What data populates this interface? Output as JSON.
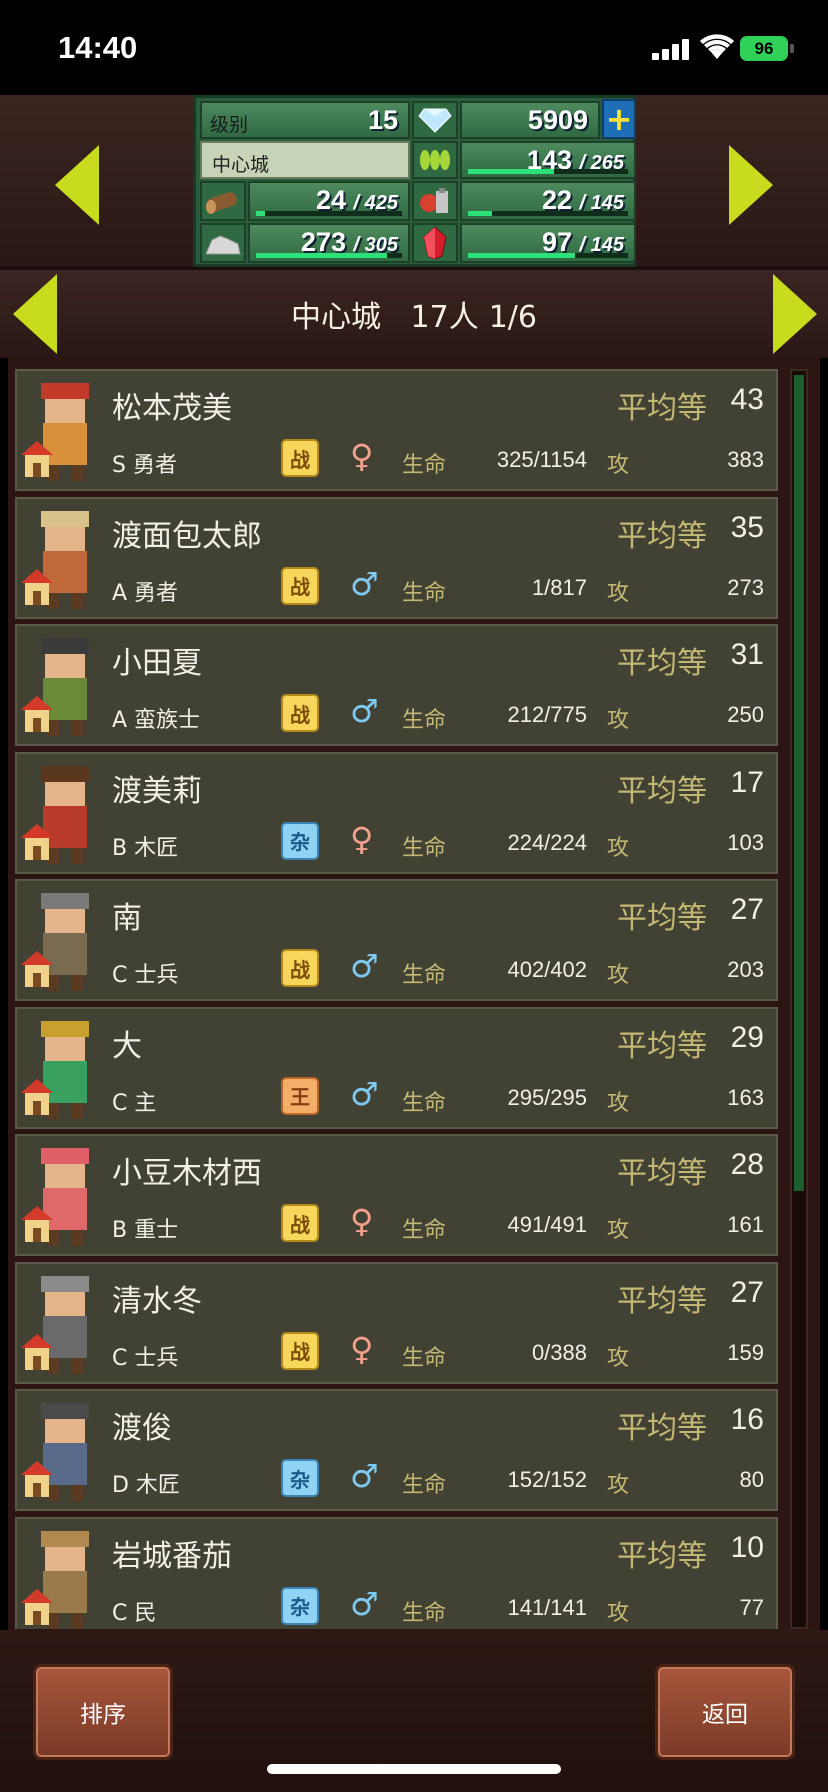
{
  "status_bar": {
    "time": "14:40",
    "battery": "96"
  },
  "stats": {
    "level_label": "级别",
    "level": "15",
    "gems": "5909",
    "town_name": "中心城",
    "food": "143",
    "food_max": "265",
    "food_fill": 0.54,
    "wood": "24",
    "wood_max": "425",
    "wood_fill": 0.06,
    "tools": "22",
    "tools_max": "145",
    "tools_fill": 0.15,
    "stone": "273",
    "stone_max": "305",
    "stone_fill": 0.9,
    "crystal": "97",
    "crystal_max": "145",
    "crystal_fill": 0.67
  },
  "header": {
    "town": "中心城",
    "population": "17人",
    "page": "1/6"
  },
  "residents": [
    {
      "name": "松本茂美",
      "grade": "平均等",
      "level": "43",
      "job": "S 勇者",
      "badge": "战",
      "badge_type": "war",
      "gender": "female",
      "hp_label": "生命",
      "hp": "325/1154",
      "atk_label": "攻",
      "atk": "383"
    },
    {
      "name": "渡面包太郎",
      "grade": "平均等",
      "level": "35",
      "job": "A 勇者",
      "badge": "战",
      "badge_type": "war",
      "gender": "male",
      "hp_label": "生命",
      "hp": "1/817",
      "atk_label": "攻",
      "atk": "273"
    },
    {
      "name": "小田夏",
      "grade": "平均等",
      "level": "31",
      "job": "A 蛮族士",
      "badge": "战",
      "badge_type": "war",
      "gender": "male",
      "hp_label": "生命",
      "hp": "212/775",
      "atk_label": "攻",
      "atk": "250"
    },
    {
      "name": "渡美莉",
      "grade": "平均等",
      "level": "17",
      "job": "B 木匠",
      "badge": "杂",
      "badge_type": "misc",
      "gender": "female",
      "hp_label": "生命",
      "hp": "224/224",
      "atk_label": "攻",
      "atk": "103"
    },
    {
      "name": "南",
      "grade": "平均等",
      "level": "27",
      "job": "C 士兵",
      "badge": "战",
      "badge_type": "war",
      "gender": "male",
      "hp_label": "生命",
      "hp": "402/402",
      "atk_label": "攻",
      "atk": "203"
    },
    {
      "name": "大",
      "grade": "平均等",
      "level": "29",
      "job": "C 主",
      "badge": "王",
      "badge_type": "king",
      "gender": "male",
      "hp_label": "生命",
      "hp": "295/295",
      "atk_label": "攻",
      "atk": "163"
    },
    {
      "name": "小豆木材西",
      "grade": "平均等",
      "level": "28",
      "job": "B 重士",
      "badge": "战",
      "badge_type": "war",
      "gender": "female",
      "hp_label": "生命",
      "hp": "491/491",
      "atk_label": "攻",
      "atk": "161"
    },
    {
      "name": "清水冬",
      "grade": "平均等",
      "level": "27",
      "job": "C 士兵",
      "badge": "战",
      "badge_type": "war",
      "gender": "female",
      "hp_label": "生命",
      "hp": "0/388",
      "atk_label": "攻",
      "atk": "159"
    },
    {
      "name": "渡俊",
      "grade": "平均等",
      "level": "16",
      "job": "D 木匠",
      "badge": "杂",
      "badge_type": "misc",
      "gender": "male",
      "hp_label": "生命",
      "hp": "152/152",
      "atk_label": "攻",
      "atk": "80"
    },
    {
      "name": "岩城番茄",
      "grade": "平均等",
      "level": "10",
      "job": "C 民",
      "badge": "杂",
      "badge_type": "misc",
      "gender": "male",
      "hp_label": "生命",
      "hp": "141/141",
      "atk_label": "攻",
      "atk": "77"
    }
  ],
  "buttons": {
    "sort": "排序",
    "back": "返回"
  },
  "colors": {
    "arrow": "#c8dc1e",
    "accent_green": "#2ee07a",
    "grade_text": "#c3b873"
  }
}
